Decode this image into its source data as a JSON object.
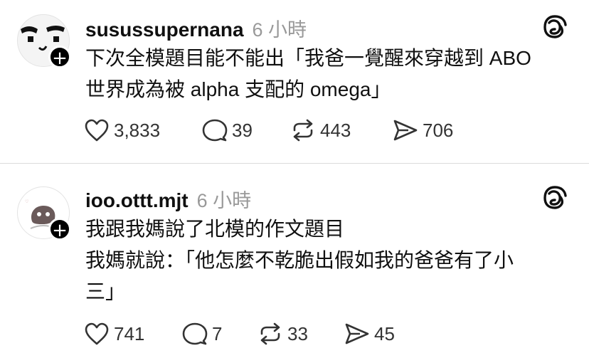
{
  "posts": [
    {
      "username": "susussupernana",
      "time": "6 小時",
      "lines": [
        "下次全模題目能不能出「我爸一覺醒來穿越到 ABO",
        "世界成為被 alpha 支配的 omega」"
      ],
      "likes": "3,833",
      "comments": "39",
      "reposts": "443",
      "shares": "706"
    },
    {
      "username": "ioo.ottt.mjt",
      "time": "6 小時",
      "lines": [
        "我跟我媽說了北模的作文題目",
        "我媽就說：「他怎麼不乾脆出假如我的爸爸有了小",
        "三」"
      ],
      "likes": "741",
      "comments": "7",
      "reposts": "33",
      "shares": "45"
    }
  ],
  "icons": {
    "like": "heart-icon",
    "comment": "comment-bubble-icon",
    "repost": "repost-icon",
    "share": "send-icon",
    "logo": "threads-logo-icon",
    "follow": "plus-icon"
  },
  "colors": {
    "text": "#101010",
    "secondary": "#999999",
    "badge": "#000000",
    "divider": "#dcdcdc"
  }
}
